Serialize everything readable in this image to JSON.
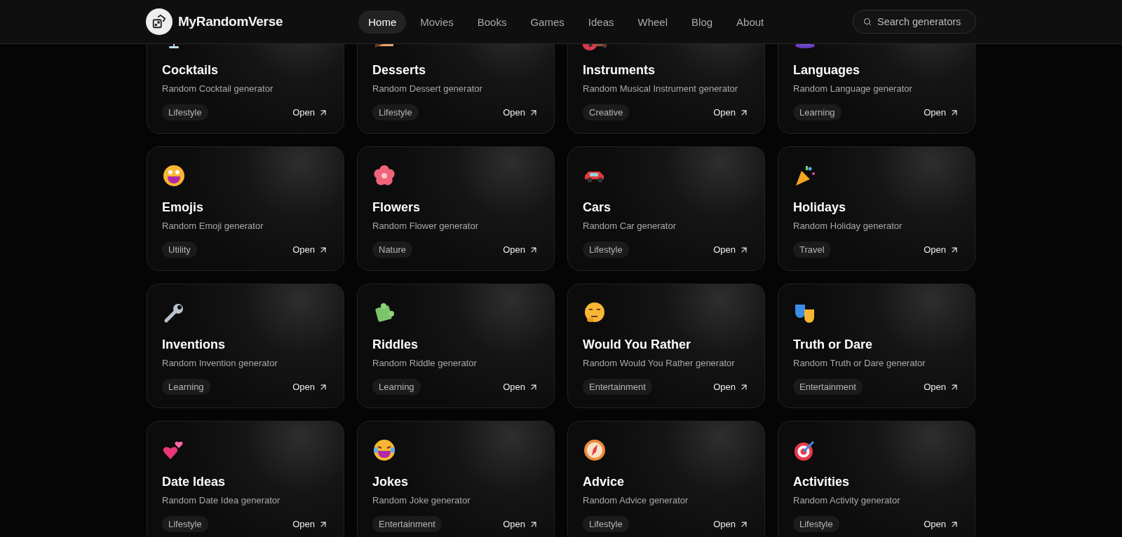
{
  "brand": "MyRandomVerse",
  "nav": [
    {
      "label": "Home",
      "selected": true
    },
    {
      "label": "Movies",
      "selected": false
    },
    {
      "label": "Books",
      "selected": false
    },
    {
      "label": "Games",
      "selected": false
    },
    {
      "label": "Ideas",
      "selected": false
    },
    {
      "label": "Wheel",
      "selected": false
    },
    {
      "label": "Blog",
      "selected": false
    },
    {
      "label": "About",
      "selected": false
    }
  ],
  "search": {
    "placeholder": "Search generators"
  },
  "cards": [
    {
      "title": "Cocktails",
      "description": "Random Cocktail generator",
      "tag": "Lifestyle",
      "action": "Open"
    },
    {
      "title": "Desserts",
      "description": "Random Dessert generator",
      "tag": "Lifestyle",
      "action": "Open"
    },
    {
      "title": "Instruments",
      "description": "Random Musical Instrument generator",
      "tag": "Creative",
      "action": "Open"
    },
    {
      "title": "Languages",
      "description": "Random Language generator",
      "tag": "Learning",
      "action": "Open"
    },
    {
      "title": "Emojis",
      "description": "Random Emoji generator",
      "tag": "Utility",
      "action": "Open"
    },
    {
      "title": "Flowers",
      "description": "Random Flower generator",
      "tag": "Nature",
      "action": "Open"
    },
    {
      "title": "Cars",
      "description": "Random Car generator",
      "tag": "Lifestyle",
      "action": "Open"
    },
    {
      "title": "Holidays",
      "description": "Random Holiday generator",
      "tag": "Travel",
      "action": "Open"
    },
    {
      "title": "Inventions",
      "description": "Random Invention generator",
      "tag": "Learning",
      "action": "Open"
    },
    {
      "title": "Riddles",
      "description": "Random Riddle generator",
      "tag": "Learning",
      "action": "Open"
    },
    {
      "title": "Would You Rather",
      "description": "Random Would You Rather generator",
      "tag": "Entertainment",
      "action": "Open"
    },
    {
      "title": "Truth or Dare",
      "description": "Random Truth or Dare generator",
      "tag": "Entertainment",
      "action": "Open"
    },
    {
      "title": "Date Ideas",
      "description": "Random Date Idea generator",
      "tag": "Lifestyle",
      "action": "Open"
    },
    {
      "title": "Jokes",
      "description": "Random Joke generator",
      "tag": "Entertainment",
      "action": "Open"
    },
    {
      "title": "Advice",
      "description": "Random Advice generator",
      "tag": "Lifestyle",
      "action": "Open"
    },
    {
      "title": "Activities",
      "description": "Random Activity generator",
      "tag": "Lifestyle",
      "action": "Open"
    }
  ]
}
